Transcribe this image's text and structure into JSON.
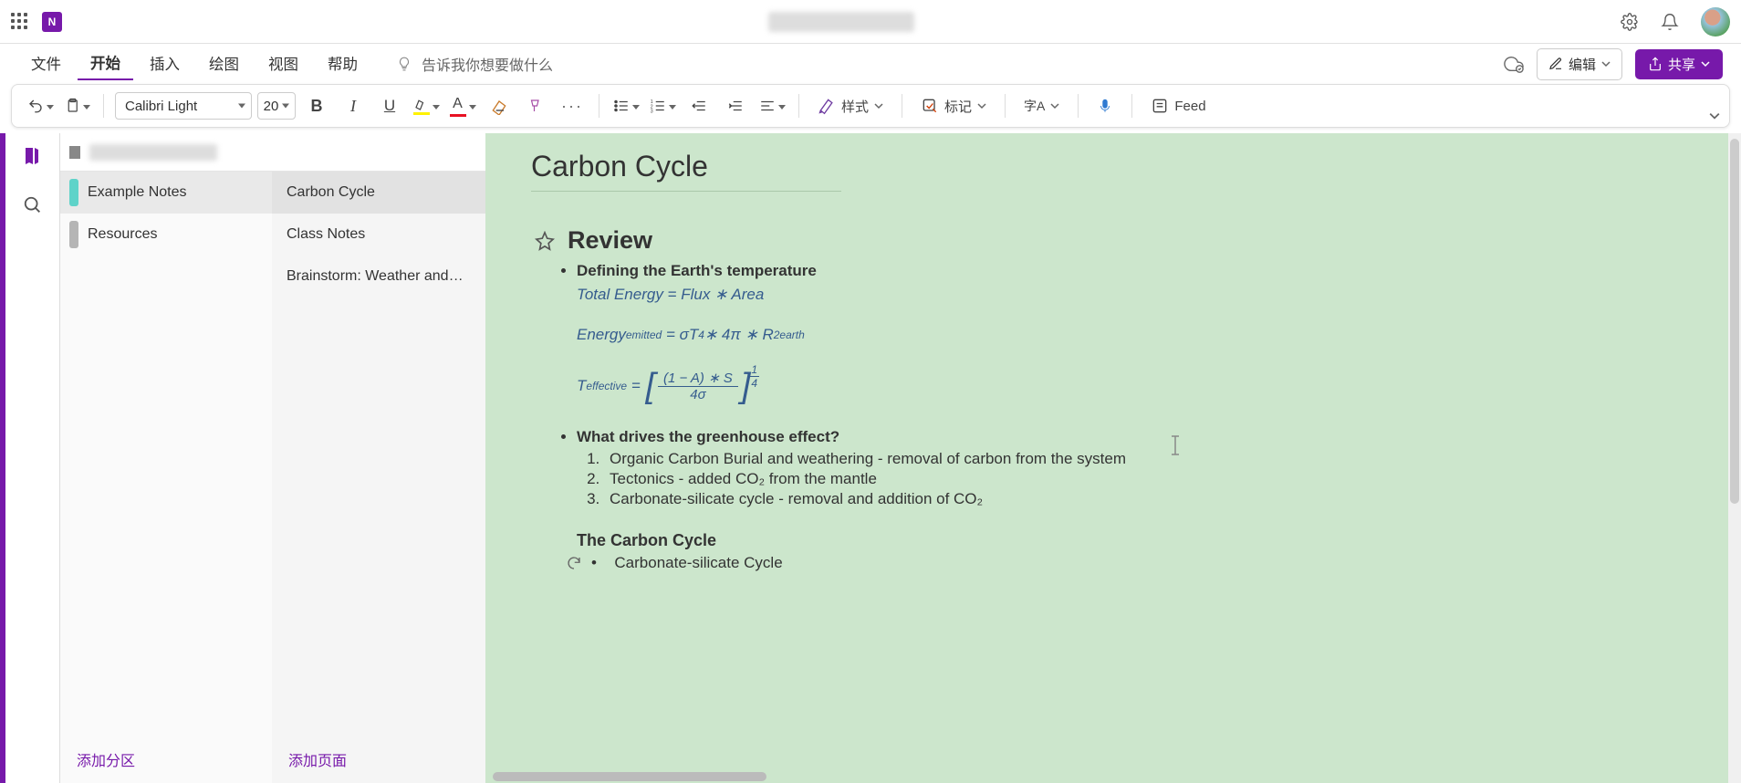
{
  "header": {
    "app_letter": "N"
  },
  "tabs": {
    "file": "文件",
    "home": "开始",
    "insert": "插入",
    "draw": "绘图",
    "view": "视图",
    "help": "帮助",
    "tell_me": "告诉我你想要做什么",
    "edit": "编辑",
    "share": "共享"
  },
  "ribbon": {
    "font_name": "Calibri Light",
    "font_size": "20",
    "styles": "样式",
    "tag": "标记",
    "lang": "字A",
    "feed": "Feed"
  },
  "sidebar": {
    "sections": [
      {
        "label": "Example Notes",
        "active": true,
        "color": "teal"
      },
      {
        "label": "Resources",
        "active": false,
        "color": "grey"
      }
    ],
    "pages": [
      {
        "label": "Carbon Cycle",
        "active": true
      },
      {
        "label": "Class Notes",
        "active": false
      },
      {
        "label": "Brainstorm: Weather and…",
        "active": false
      }
    ],
    "add_section": "添加分区",
    "add_page": "添加页面"
  },
  "page": {
    "title": "Carbon Cycle",
    "review_heading": "Review",
    "defining": "Defining the Earth's temperature",
    "eq_total_lhs": "Total Energy",
    "eq_total_rhs": "Flux ∗ Area",
    "eq_emit_lhs": "Energy",
    "eq_emit_lhs_sub": "emitted",
    "eq_emit_rhs_a": "σT",
    "eq_emit_rhs_a_sup": "4",
    "eq_emit_rhs_b": " ∗ 4π ∗ R",
    "eq_emit_rhs_b_sup": "2",
    "eq_emit_rhs_b_sub": "earth",
    "eq_teff_lhs": "T",
    "eq_teff_lhs_sub": "effective",
    "eq_teff_num": "(1 − A) ∗ S",
    "eq_teff_den": "4σ",
    "eq_teff_outer_num": "1",
    "eq_teff_outer_den": "4",
    "greenhouse_q": "What drives the greenhouse effect?",
    "drivers": [
      "Organic Carbon Burial and weathering - removal of carbon from the system",
      "Tectonics - added CO₂ from the mantle",
      "Carbonate-silicate cycle - removal and addition of CO₂"
    ],
    "carbon_cycle_title": "The Carbon Cycle",
    "carbonate_silicate": "Carbonate-silicate Cycle"
  }
}
